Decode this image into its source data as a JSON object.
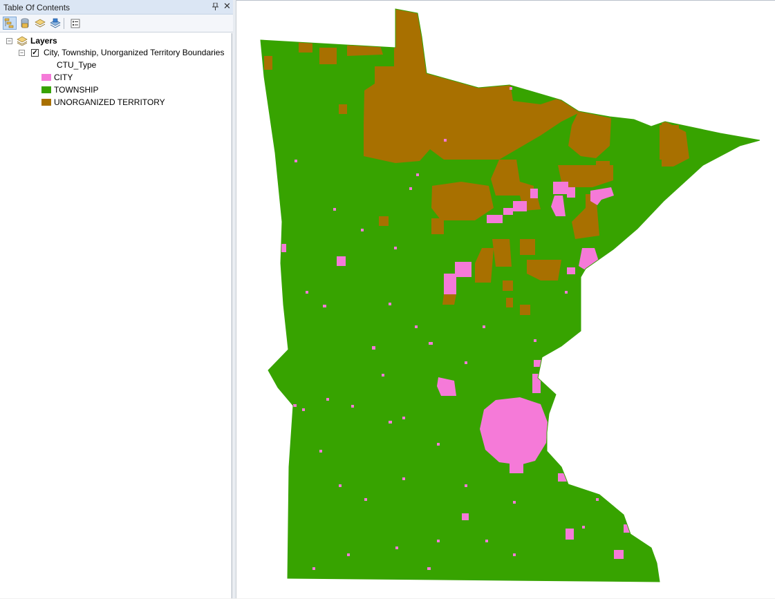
{
  "toc": {
    "title": "Table Of Contents",
    "pin_icon": "pin-icon",
    "close_icon": "close-icon",
    "toolbar_icons": [
      "list-by-drawing-order-icon",
      "list-by-source-icon",
      "list-by-visibility-icon",
      "list-by-selection-icon",
      "options-icon"
    ],
    "root_label": "Layers",
    "layer": {
      "name": "City, Township, Unorganized Territory Boundaries",
      "visible": true,
      "field": "CTU_Type",
      "classes": [
        {
          "label": "CITY",
          "color": "#f57ad8"
        },
        {
          "label": "TOWNSHIP",
          "color": "#37a300"
        },
        {
          "label": "UNORGANIZED TERRITORY",
          "color": "#a87000"
        }
      ]
    }
  },
  "map": {
    "state": "Minnesota",
    "colors": {
      "township": "#37a300",
      "city": "#f57ad8",
      "unorganized": "#a87000"
    }
  }
}
